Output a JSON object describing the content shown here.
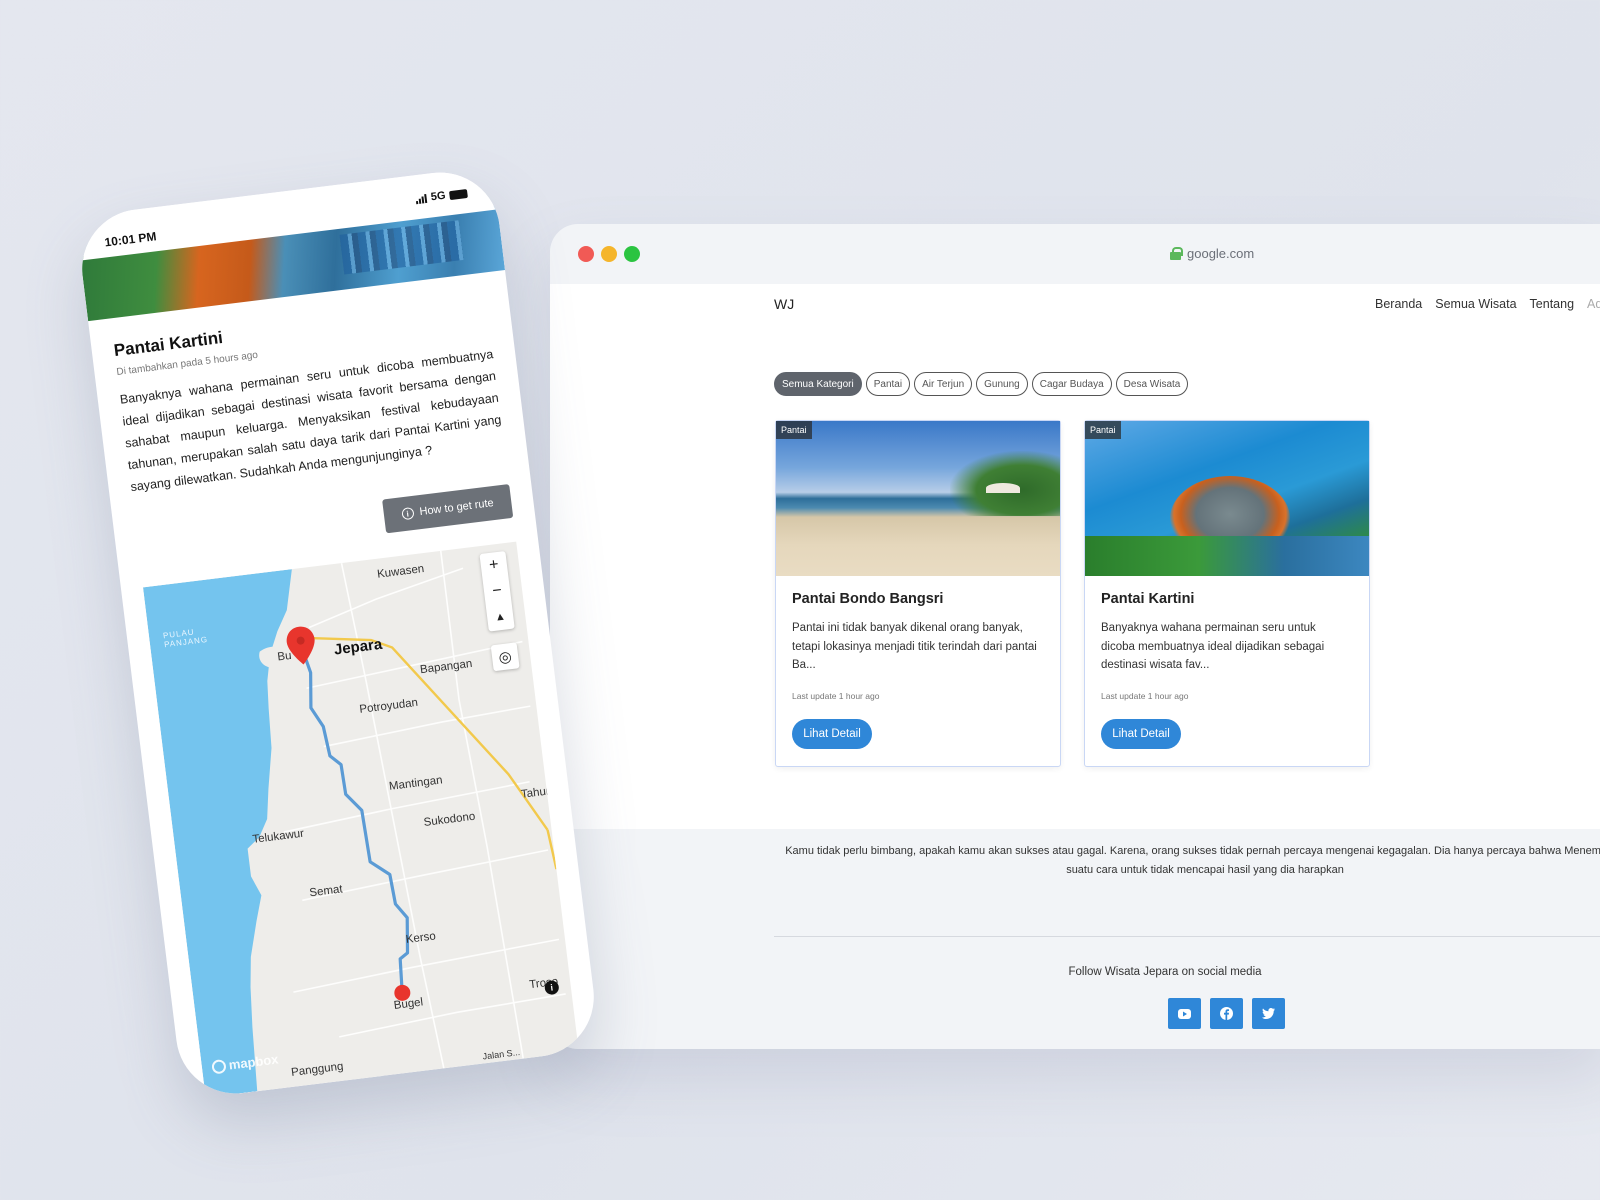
{
  "browser": {
    "url": "google.com",
    "brand": "WJ",
    "nav": [
      "Beranda",
      "Semua Wisata",
      "Tentang",
      "Adr"
    ],
    "categories": [
      "Semua Kategori",
      "Pantai",
      "Air Terjun",
      "Gunung",
      "Cagar Budaya",
      "Desa Wisata"
    ],
    "active_category": "Semua Kategori",
    "cards": [
      {
        "tag": "Pantai",
        "title": "Pantai Bondo Bangsri",
        "desc": "Pantai ini tidak banyak dikenal orang banyak, tetapi lokasinya menjadi titik terindah dari pantai Ba...",
        "updated": "Last update 1 hour ago",
        "button": "Lihat Detail"
      },
      {
        "tag": "Pantai",
        "title": "Pantai Kartini",
        "desc": "Banyaknya wahana permainan seru untuk dicoba membuatnya ideal dijadikan sebagai destinasi wisata fav...",
        "updated": "Last update 1 hour ago",
        "button": "Lihat Detail"
      }
    ],
    "footer": {
      "quote": "Kamu tidak perlu bimbang, apakah kamu akan sukses atau gagal. Karena, orang sukses tidak pernah percaya mengenai kegagalan. Dia hanya percaya bahwa Menemukan suatu cara untuk tidak mencapai hasil yang dia harapkan",
      "follow": "Follow Wisata Jepara on social media",
      "socials": [
        "youtube-icon",
        "facebook-icon",
        "twitter-icon"
      ]
    },
    "accent": "#2f87d8"
  },
  "phone": {
    "time": "10:01 PM",
    "network": "5G",
    "title": "Pantai Kartini",
    "subtitle": "Di tambahkan pada 5 hours ago",
    "body": "Banyaknya wahana permainan seru untuk dicoba membuatnya ideal dijadikan sebagai destinasi wisata favorit bersama dengan sahabat maupun keluarga. Menyaksikan festival kebudayaan tahunan, merupakan salah satu daya tarik dari Pantai Kartini yang sayang dilewatkan. Sudahkah Anda mengunjunginya ?",
    "route_button": "How to get rute",
    "map": {
      "labels": {
        "kuwasen": "Kuwasen",
        "pulau": "PULAU PANJANG",
        "bu": "Bu",
        "jepara": "Jepara",
        "bapangan": "Bapangan",
        "potroyudan": "Potroyudan",
        "mantingan": "Mantingan",
        "telukawur": "Telukawur",
        "tahunan": "Tahuna",
        "sukodono": "Sukodono",
        "semat": "Semat",
        "kerso": "Kerso",
        "bugel": "Bugel",
        "troso": "Troso",
        "panggung": "Panggung",
        "jalan": "Jalan S..."
      },
      "attribution": "mapbox",
      "route_color": "#5b9bd5",
      "marker_color": "#e8352d",
      "sea_color": "#74c4ee"
    }
  }
}
